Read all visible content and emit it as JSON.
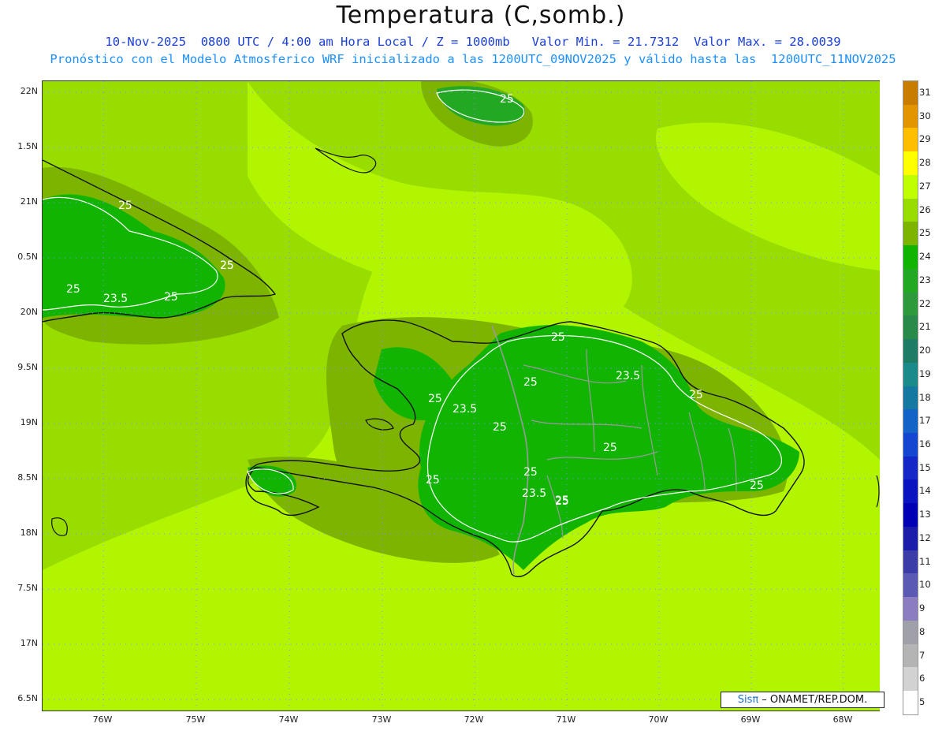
{
  "title": "Temperatura (C,somb.)",
  "subtitle1": "10-Nov-2025  0800 UTC / 4:00 am Hora Local / Z = 1000mb   Valor Min. = 21.7312  Valor Max. = 28.0039",
  "subtitle2": "Pronóstico con el Modelo Atmosferico WRF inicializado a las 1200UTC_09NOV2025 y válido hasta las  1200UTC_11NOV2025",
  "latitude_labels": [
    "22N",
    "1.5N",
    "21N",
    "0.5N",
    "20N",
    "9.5N",
    "19N",
    "8.5N",
    "18N",
    "7.5N",
    "17N",
    "6.5N"
  ],
  "longitude_labels": [
    "76W",
    "75W",
    "74W",
    "73W",
    "72W",
    "71W",
    "70W",
    "69W",
    "68W"
  ],
  "colorbar": {
    "labels": [
      "31",
      "30",
      "29",
      "28",
      "27",
      "26",
      "25",
      "24",
      "23",
      "22",
      "21",
      "20",
      "19",
      "18",
      "17",
      "16",
      "15",
      "14",
      "13",
      "12",
      "11",
      "10",
      "9",
      "8",
      "7",
      "6",
      "5"
    ],
    "colors": [
      "#c87d00",
      "#e39500",
      "#ffbf00",
      "#ffff00",
      "#c0ff00",
      "#98dc00",
      "#7cb400",
      "#11b400",
      "#23a823",
      "#2e9a3c",
      "#2a8a4a",
      "#1e7c64",
      "#1a8a8a",
      "#1478a0",
      "#1464c8",
      "#1446d2",
      "#1428c8",
      "#0a14c0",
      "#0000b4",
      "#1c1caa",
      "#3c3ca8",
      "#5a5ab4",
      "#8c7cc0",
      "#a0a0aa",
      "#b4b4b4",
      "#d2d2d2",
      "#ffffff"
    ]
  },
  "contour_labels": [
    "25",
    "25",
    "25",
    "25",
    "23.5",
    "25",
    "25",
    "25",
    "25",
    "25",
    "23.5",
    "25",
    "23.5",
    "25",
    "25",
    "25",
    "25",
    "25",
    "23.5",
    "25",
    "25"
  ],
  "credit": {
    "brand": "Sisπ",
    "text": "– ONAMET/REP.DOM."
  }
}
